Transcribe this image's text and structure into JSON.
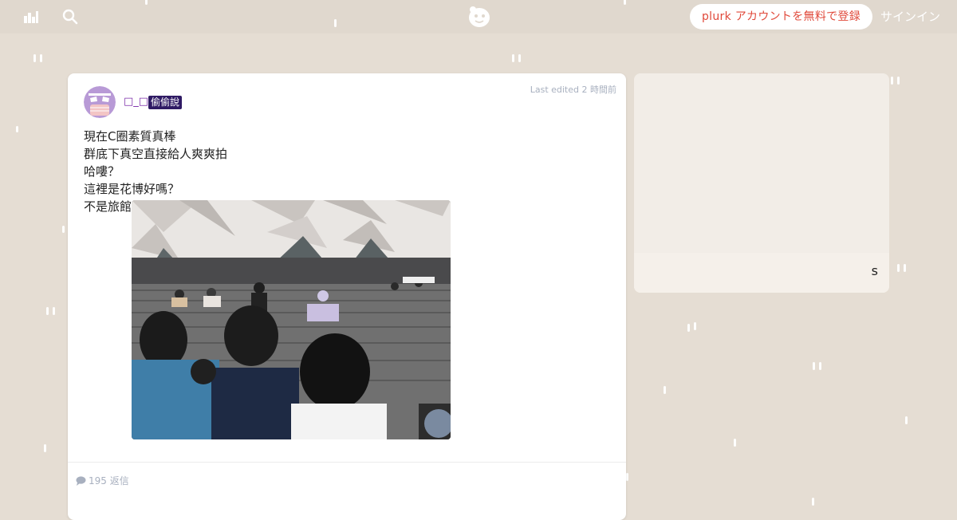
{
  "header": {
    "signup_label": "plurk アカウントを無料で登録",
    "signin_label": "サインイン",
    "icons": [
      "timeline-icon",
      "search-icon",
      "plurk-logo-icon"
    ]
  },
  "post": {
    "edited_text": "Last edited 2 時間前",
    "username": "□_□",
    "qualifier": "偷偷說",
    "lines": [
      "現在C圈素質真棒",
      "群底下真空直接給人爽爽拍",
      "哈嘍？",
      "這裡是花博好嗎？",
      "不是旅館"
    ],
    "responses_text": "195 返信"
  },
  "sidebar": {
    "letter": "s"
  },
  "colors": {
    "background": "#e5ddd3",
    "topbar": "#e0d8ce",
    "accent": "#e0493a",
    "qualifier_bg": "#2f1a64",
    "username": "#7a2aa8",
    "muted": "#a8b0bf"
  }
}
